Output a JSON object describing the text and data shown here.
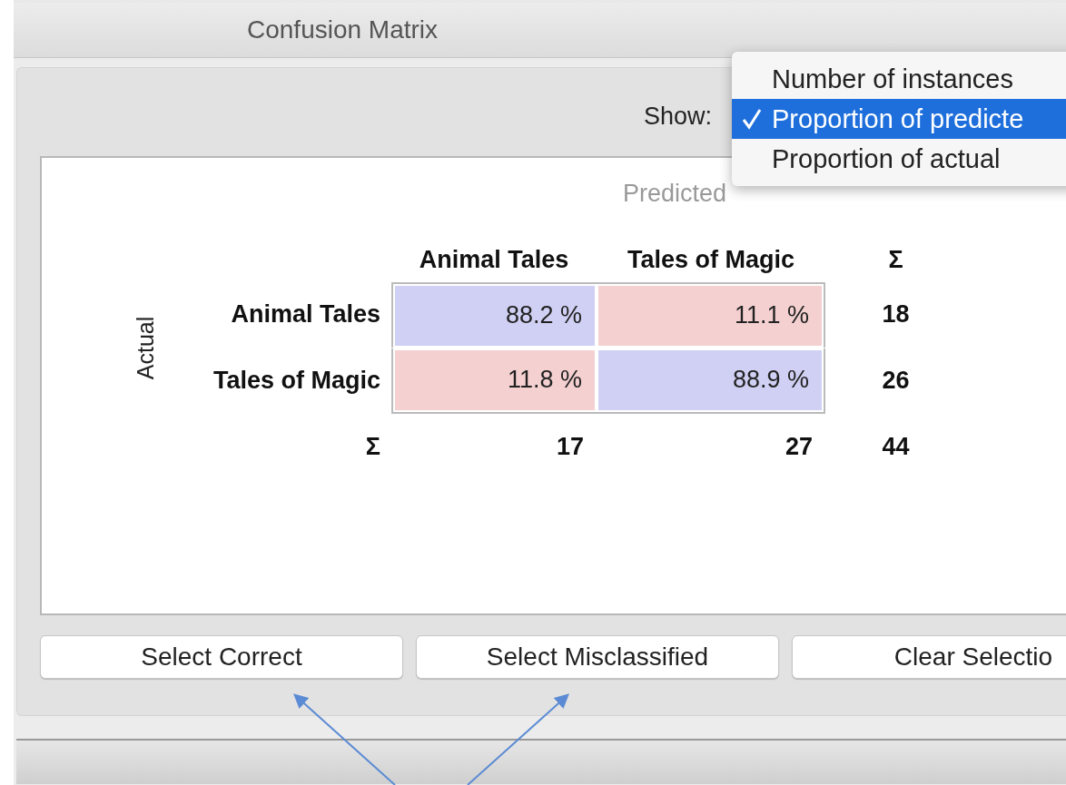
{
  "window": {
    "title": "Confusion Matrix"
  },
  "show": {
    "label": "Show:",
    "menu": [
      {
        "label": "Number of instances",
        "selected": false
      },
      {
        "label": "Proportion of predicte",
        "selected": true
      },
      {
        "label": "Proportion of actual",
        "selected": false
      }
    ]
  },
  "matrix": {
    "predicted_label": "Predicted",
    "actual_label": "Actual",
    "columns": [
      "Animal Tales",
      "Tales of Magic"
    ],
    "sum_label": "Σ",
    "rows": [
      {
        "label": "Animal Tales",
        "cells": [
          {
            "text": "88.2 %",
            "color": "#d0d0f4"
          },
          {
            "text": "11.1 %",
            "color": "#f4d0d0"
          }
        ],
        "sum": "18"
      },
      {
        "label": "Tales of Magic",
        "cells": [
          {
            "text": "11.8 %",
            "color": "#f4d0d0"
          },
          {
            "text": "88.9 %",
            "color": "#d0d0f4"
          }
        ],
        "sum": "26"
      }
    ],
    "sum_row_label": "Σ",
    "column_sums": [
      "17",
      "27"
    ],
    "total": "44"
  },
  "buttons": [
    "Select Correct",
    "Select Misclassified",
    "Clear Selectio"
  ]
}
